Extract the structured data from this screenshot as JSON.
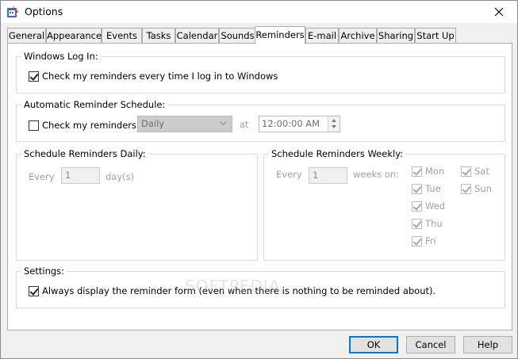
{
  "window": {
    "title": "Options",
    "icon": "options-app-icon"
  },
  "tabs": [
    {
      "label": "General"
    },
    {
      "label": "Appearance"
    },
    {
      "label": "Events"
    },
    {
      "label": "Tasks"
    },
    {
      "label": "Calendar"
    },
    {
      "label": "Sounds"
    },
    {
      "label": "Reminders",
      "active": true
    },
    {
      "label": "E-mail"
    },
    {
      "label": "Archive"
    },
    {
      "label": "Sharing"
    },
    {
      "label": "Start Up"
    }
  ],
  "windows_login": {
    "title": "Windows Log In:",
    "checkbox_label": "Check my reminders every time I log in to Windows",
    "checked": true
  },
  "auto_schedule": {
    "title": "Automatic Reminder Schedule:",
    "checkbox_label": "Check my reminders",
    "checked": false,
    "frequency": "Daily",
    "at_label": "at",
    "time": "12:00:00 AM"
  },
  "daily": {
    "title": "Schedule Reminders Daily:",
    "every_label": "Every",
    "value": "1",
    "unit": "day(s)"
  },
  "weekly": {
    "title": "Schedule Reminders Weekly:",
    "every_label": "Every",
    "value": "1",
    "unit": "weeks on:",
    "days": [
      {
        "label": "Mon",
        "checked": true
      },
      {
        "label": "Tue",
        "checked": true
      },
      {
        "label": "Wed",
        "checked": true
      },
      {
        "label": "Thu",
        "checked": true
      },
      {
        "label": "Fri",
        "checked": true
      },
      {
        "label": "Sat",
        "checked": true
      },
      {
        "label": "Sun",
        "checked": true
      }
    ]
  },
  "settings": {
    "title": "Settings:",
    "checkbox_label": "Always display the reminder form (even when there is nothing to be reminded about).",
    "checked": true
  },
  "buttons": {
    "ok": "OK",
    "cancel": "Cancel",
    "help": "Help"
  },
  "watermark": "SOFTPEDIA",
  "colors": {
    "accent": "#0078d7",
    "panel": "#ffffff",
    "chrome": "#f0f0f0"
  }
}
